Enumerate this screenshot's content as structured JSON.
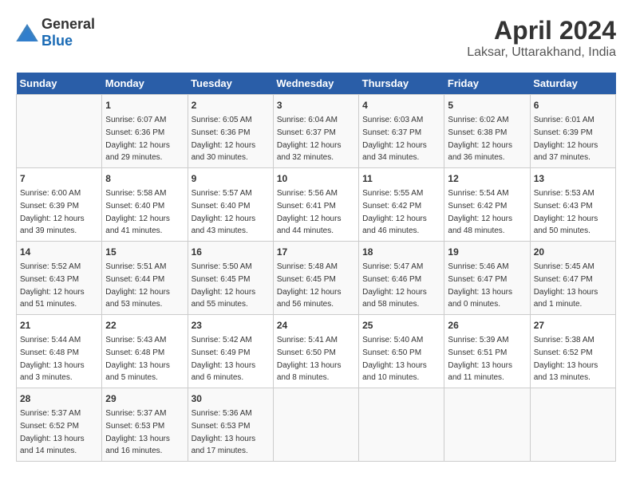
{
  "logo": {
    "text_general": "General",
    "text_blue": "Blue"
  },
  "title": "April 2024",
  "subtitle": "Laksar, Uttarakhand, India",
  "calendar": {
    "headers": [
      "Sunday",
      "Monday",
      "Tuesday",
      "Wednesday",
      "Thursday",
      "Friday",
      "Saturday"
    ],
    "weeks": [
      [
        {
          "day": "",
          "sunrise": "",
          "sunset": "",
          "daylight": ""
        },
        {
          "day": "1",
          "sunrise": "Sunrise: 6:07 AM",
          "sunset": "Sunset: 6:36 PM",
          "daylight": "Daylight: 12 hours and 29 minutes."
        },
        {
          "day": "2",
          "sunrise": "Sunrise: 6:05 AM",
          "sunset": "Sunset: 6:36 PM",
          "daylight": "Daylight: 12 hours and 30 minutes."
        },
        {
          "day": "3",
          "sunrise": "Sunrise: 6:04 AM",
          "sunset": "Sunset: 6:37 PM",
          "daylight": "Daylight: 12 hours and 32 minutes."
        },
        {
          "day": "4",
          "sunrise": "Sunrise: 6:03 AM",
          "sunset": "Sunset: 6:37 PM",
          "daylight": "Daylight: 12 hours and 34 minutes."
        },
        {
          "day": "5",
          "sunrise": "Sunrise: 6:02 AM",
          "sunset": "Sunset: 6:38 PM",
          "daylight": "Daylight: 12 hours and 36 minutes."
        },
        {
          "day": "6",
          "sunrise": "Sunrise: 6:01 AM",
          "sunset": "Sunset: 6:39 PM",
          "daylight": "Daylight: 12 hours and 37 minutes."
        }
      ],
      [
        {
          "day": "7",
          "sunrise": "Sunrise: 6:00 AM",
          "sunset": "Sunset: 6:39 PM",
          "daylight": "Daylight: 12 hours and 39 minutes."
        },
        {
          "day": "8",
          "sunrise": "Sunrise: 5:58 AM",
          "sunset": "Sunset: 6:40 PM",
          "daylight": "Daylight: 12 hours and 41 minutes."
        },
        {
          "day": "9",
          "sunrise": "Sunrise: 5:57 AM",
          "sunset": "Sunset: 6:40 PM",
          "daylight": "Daylight: 12 hours and 43 minutes."
        },
        {
          "day": "10",
          "sunrise": "Sunrise: 5:56 AM",
          "sunset": "Sunset: 6:41 PM",
          "daylight": "Daylight: 12 hours and 44 minutes."
        },
        {
          "day": "11",
          "sunrise": "Sunrise: 5:55 AM",
          "sunset": "Sunset: 6:42 PM",
          "daylight": "Daylight: 12 hours and 46 minutes."
        },
        {
          "day": "12",
          "sunrise": "Sunrise: 5:54 AM",
          "sunset": "Sunset: 6:42 PM",
          "daylight": "Daylight: 12 hours and 48 minutes."
        },
        {
          "day": "13",
          "sunrise": "Sunrise: 5:53 AM",
          "sunset": "Sunset: 6:43 PM",
          "daylight": "Daylight: 12 hours and 50 minutes."
        }
      ],
      [
        {
          "day": "14",
          "sunrise": "Sunrise: 5:52 AM",
          "sunset": "Sunset: 6:43 PM",
          "daylight": "Daylight: 12 hours and 51 minutes."
        },
        {
          "day": "15",
          "sunrise": "Sunrise: 5:51 AM",
          "sunset": "Sunset: 6:44 PM",
          "daylight": "Daylight: 12 hours and 53 minutes."
        },
        {
          "day": "16",
          "sunrise": "Sunrise: 5:50 AM",
          "sunset": "Sunset: 6:45 PM",
          "daylight": "Daylight: 12 hours and 55 minutes."
        },
        {
          "day": "17",
          "sunrise": "Sunrise: 5:48 AM",
          "sunset": "Sunset: 6:45 PM",
          "daylight": "Daylight: 12 hours and 56 minutes."
        },
        {
          "day": "18",
          "sunrise": "Sunrise: 5:47 AM",
          "sunset": "Sunset: 6:46 PM",
          "daylight": "Daylight: 12 hours and 58 minutes."
        },
        {
          "day": "19",
          "sunrise": "Sunrise: 5:46 AM",
          "sunset": "Sunset: 6:47 PM",
          "daylight": "Daylight: 13 hours and 0 minutes."
        },
        {
          "day": "20",
          "sunrise": "Sunrise: 5:45 AM",
          "sunset": "Sunset: 6:47 PM",
          "daylight": "Daylight: 13 hours and 1 minute."
        }
      ],
      [
        {
          "day": "21",
          "sunrise": "Sunrise: 5:44 AM",
          "sunset": "Sunset: 6:48 PM",
          "daylight": "Daylight: 13 hours and 3 minutes."
        },
        {
          "day": "22",
          "sunrise": "Sunrise: 5:43 AM",
          "sunset": "Sunset: 6:48 PM",
          "daylight": "Daylight: 13 hours and 5 minutes."
        },
        {
          "day": "23",
          "sunrise": "Sunrise: 5:42 AM",
          "sunset": "Sunset: 6:49 PM",
          "daylight": "Daylight: 13 hours and 6 minutes."
        },
        {
          "day": "24",
          "sunrise": "Sunrise: 5:41 AM",
          "sunset": "Sunset: 6:50 PM",
          "daylight": "Daylight: 13 hours and 8 minutes."
        },
        {
          "day": "25",
          "sunrise": "Sunrise: 5:40 AM",
          "sunset": "Sunset: 6:50 PM",
          "daylight": "Daylight: 13 hours and 10 minutes."
        },
        {
          "day": "26",
          "sunrise": "Sunrise: 5:39 AM",
          "sunset": "Sunset: 6:51 PM",
          "daylight": "Daylight: 13 hours and 11 minutes."
        },
        {
          "day": "27",
          "sunrise": "Sunrise: 5:38 AM",
          "sunset": "Sunset: 6:52 PM",
          "daylight": "Daylight: 13 hours and 13 minutes."
        }
      ],
      [
        {
          "day": "28",
          "sunrise": "Sunrise: 5:37 AM",
          "sunset": "Sunset: 6:52 PM",
          "daylight": "Daylight: 13 hours and 14 minutes."
        },
        {
          "day": "29",
          "sunrise": "Sunrise: 5:37 AM",
          "sunset": "Sunset: 6:53 PM",
          "daylight": "Daylight: 13 hours and 16 minutes."
        },
        {
          "day": "30",
          "sunrise": "Sunrise: 5:36 AM",
          "sunset": "Sunset: 6:53 PM",
          "daylight": "Daylight: 13 hours and 17 minutes."
        },
        {
          "day": "",
          "sunrise": "",
          "sunset": "",
          "daylight": ""
        },
        {
          "day": "",
          "sunrise": "",
          "sunset": "",
          "daylight": ""
        },
        {
          "day": "",
          "sunrise": "",
          "sunset": "",
          "daylight": ""
        },
        {
          "day": "",
          "sunrise": "",
          "sunset": "",
          "daylight": ""
        }
      ]
    ]
  }
}
